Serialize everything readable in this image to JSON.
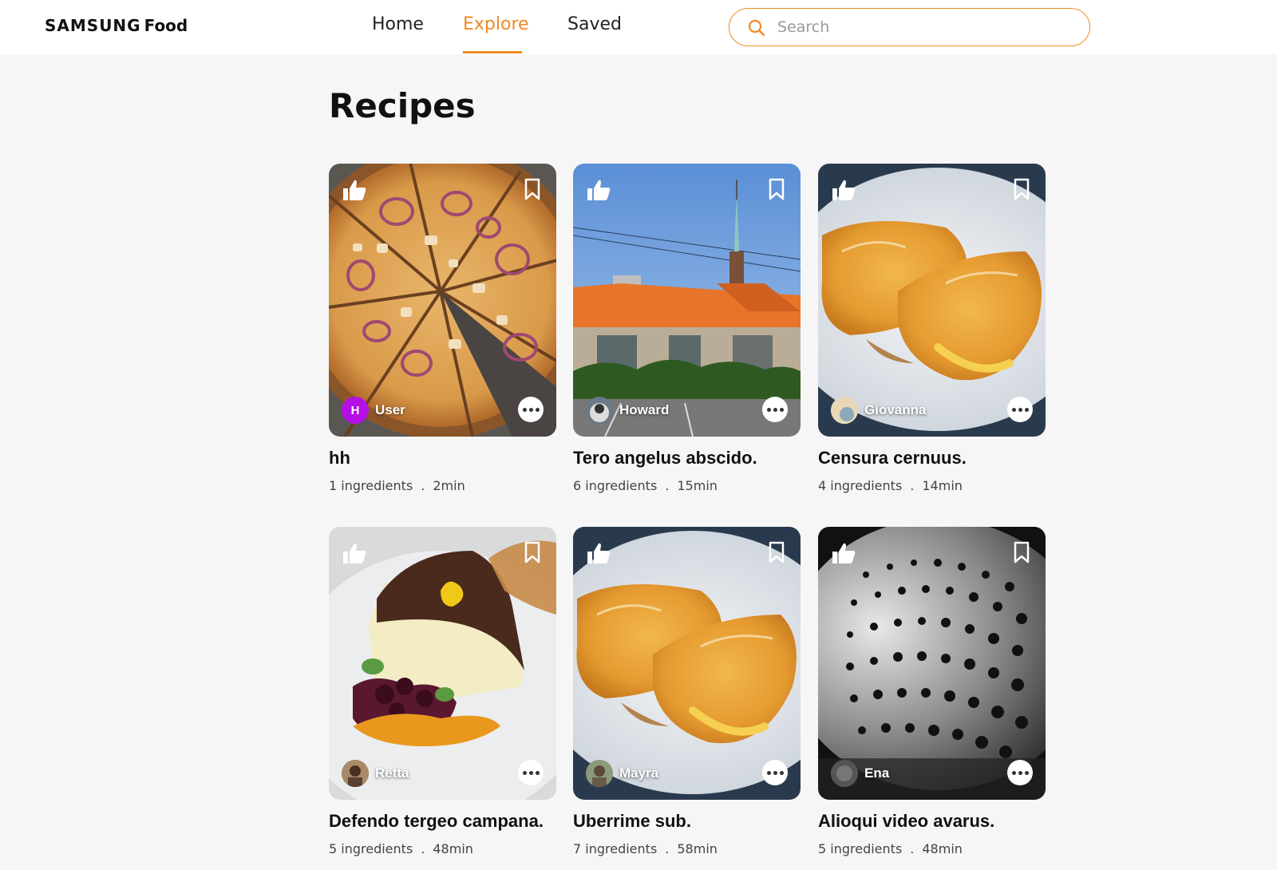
{
  "header": {
    "logo_brand": "SAMSUNG",
    "logo_product": "Food",
    "nav": [
      {
        "label": "Home",
        "active": false
      },
      {
        "label": "Explore",
        "active": true
      },
      {
        "label": "Saved",
        "active": false
      }
    ],
    "search": {
      "placeholder": "Search",
      "value": ""
    }
  },
  "accent_color": "#f08a24",
  "main": {
    "title": "Recipes",
    "recipes": [
      {
        "title": "hh",
        "ingredients": "1 ingredients",
        "separator": ".",
        "time": "2min",
        "author": "User",
        "avatar_letter": "H",
        "image": "pizza"
      },
      {
        "title": "Tero angelus abscido.",
        "ingredients": "6 ingredients",
        "separator": ".",
        "time": "15min",
        "author": "Howard",
        "avatar_letter": "",
        "image": "building"
      },
      {
        "title": "Censura cernuus.",
        "ingredients": "4 ingredients",
        "separator": ".",
        "time": "14min",
        "author": "Giovanna",
        "avatar_letter": "",
        "image": "omelette"
      },
      {
        "title": "Defendo tergeo campana.",
        "ingredients": "5 ingredients",
        "separator": ".",
        "time": "48min",
        "author": "Retta",
        "avatar_letter": "",
        "image": "cheesecake"
      },
      {
        "title": "Uberrime sub.",
        "ingredients": "7 ingredients",
        "separator": ".",
        "time": "58min",
        "author": "Mayra",
        "avatar_letter": "",
        "image": "omelette"
      },
      {
        "title": "Alioqui video avarus.",
        "ingredients": "5 ingredients",
        "separator": ".",
        "time": "48min",
        "author": "Ena",
        "avatar_letter": "",
        "image": "colander"
      }
    ]
  }
}
